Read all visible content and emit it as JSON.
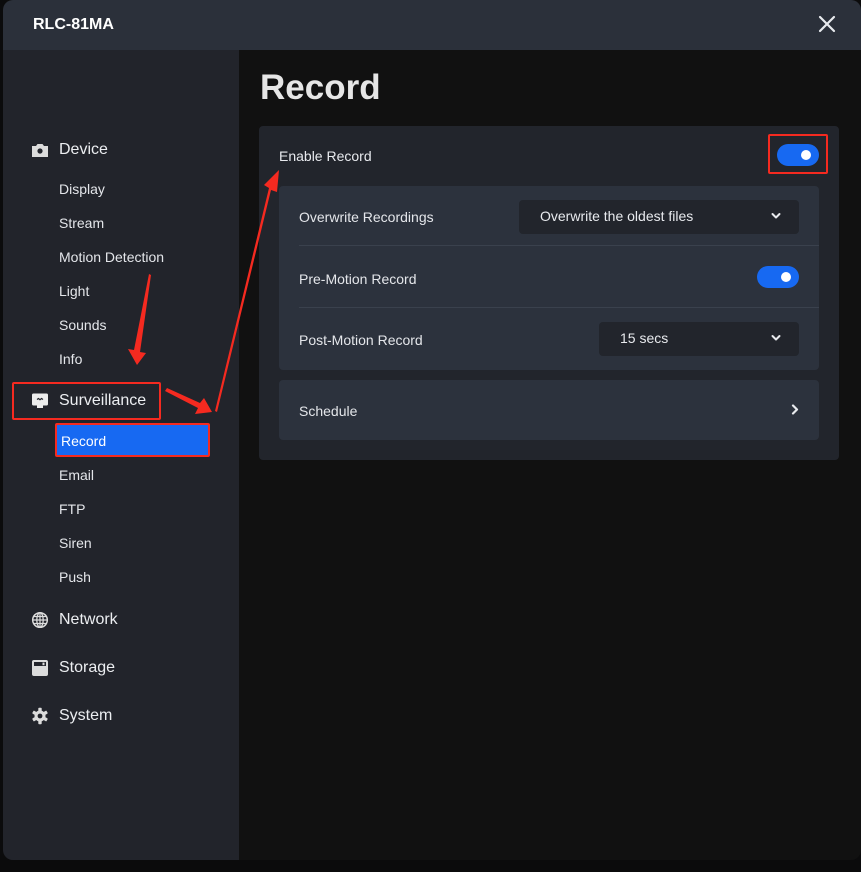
{
  "window": {
    "title": "RLC-81MA",
    "close_icon": "close-icon"
  },
  "sidebar": {
    "groups": [
      {
        "label": "Device",
        "icon": "camera-icon",
        "items": [
          "Display",
          "Stream",
          "Motion Detection",
          "Light",
          "Sounds",
          "Info"
        ]
      },
      {
        "label": "Surveillance",
        "icon": "monitor-icon",
        "items": [
          "Record",
          "Email",
          "FTP",
          "Siren",
          "Push"
        ],
        "active_item": "Record"
      },
      {
        "label": "Network",
        "icon": "globe-icon",
        "items": []
      },
      {
        "label": "Storage",
        "icon": "storage-icon",
        "items": []
      },
      {
        "label": "System",
        "icon": "gear-icon",
        "items": []
      }
    ]
  },
  "main": {
    "page_title": "Record",
    "enable_record": {
      "label": "Enable Record",
      "enabled": true
    },
    "settings": {
      "overwrite": {
        "label": "Overwrite Recordings",
        "value": "Overwrite the oldest files"
      },
      "pre_motion": {
        "label": "Pre-Motion Record",
        "enabled": true
      },
      "post_motion": {
        "label": "Post-Motion Record",
        "value": "15 secs"
      }
    },
    "schedule": {
      "label": "Schedule"
    }
  },
  "colors": {
    "accent": "#1769f2",
    "annotation": "#f52a20",
    "sidebar_bg": "#22242b",
    "titlebar_bg": "#2b303a",
    "main_bg": "#111111",
    "card_bg": "#22252c",
    "subcard_bg": "#2c323d"
  }
}
